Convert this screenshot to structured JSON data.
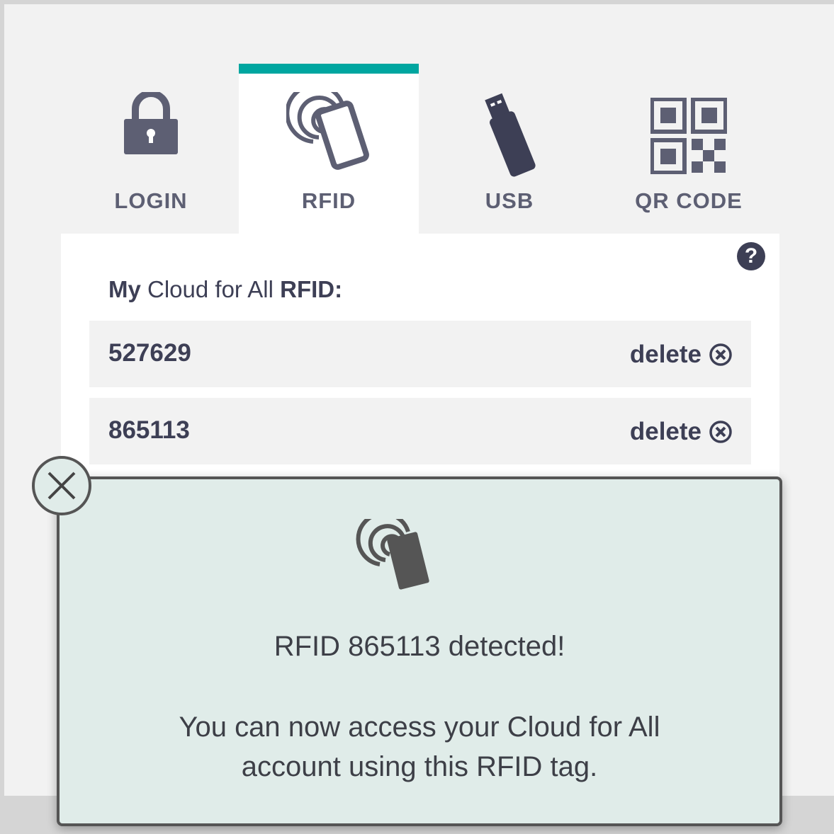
{
  "tabs": [
    {
      "id": "login",
      "label": "LOGIN",
      "icon": "lock-icon",
      "active": false
    },
    {
      "id": "rfid",
      "label": "RFID",
      "icon": "rfid-card-icon",
      "active": true
    },
    {
      "id": "usb",
      "label": "USB",
      "icon": "usb-stick-icon",
      "active": false
    },
    {
      "id": "qr",
      "label": "QR CODE",
      "icon": "qr-code-icon",
      "active": false
    }
  ],
  "panel": {
    "heading_my": "My",
    "heading_mid": "Cloud for All",
    "heading_rfid": "RFID:",
    "rows": [
      {
        "number": "527629",
        "delete_label": "delete"
      },
      {
        "number": "865113",
        "delete_label": "delete"
      }
    ]
  },
  "dialog": {
    "message_line1": "RFID 865113 detected!",
    "message_line2": "You can now access your Cloud for All account using this RFID tag."
  },
  "colors": {
    "accent": "#00a6a0",
    "text": "#3d3f55",
    "dialog_bg": "#e0ece9"
  }
}
